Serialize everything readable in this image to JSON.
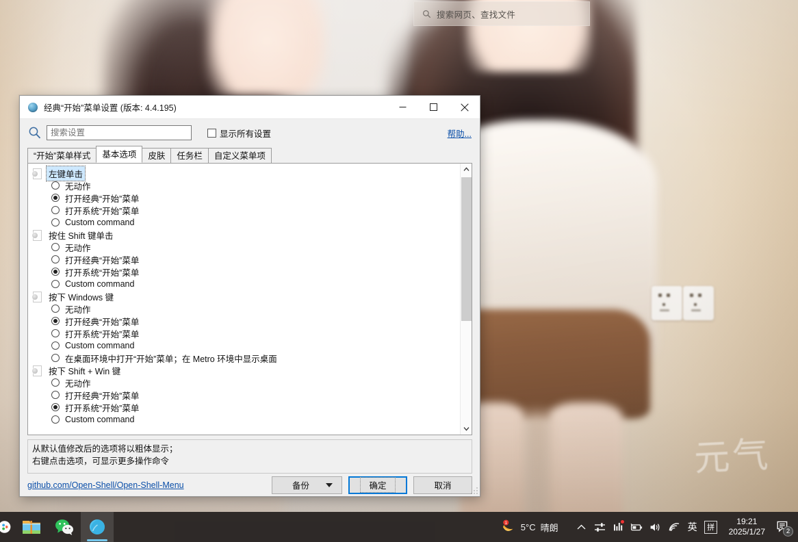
{
  "desktop": {
    "search": {
      "placeholder": "搜索网页、查找文件",
      "icon": "search-icon"
    },
    "watermark": "元气"
  },
  "dialog": {
    "title": "经典“开始”菜单设置 (版本: 4.4.195)",
    "icon": "open-shell-icon",
    "window_controls": {
      "minimize": "minimize-icon",
      "maximize": "maximize-icon",
      "close": "close-icon"
    },
    "search": {
      "placeholder": "搜索设置",
      "value": "",
      "icon": "magnifier-icon"
    },
    "show_all_checkbox": {
      "label": "显示所有设置",
      "checked": false
    },
    "help_link": "帮助...",
    "tabs": [
      {
        "label": "“开始”菜单样式",
        "active": false
      },
      {
        "label": "基本选项",
        "active": true
      },
      {
        "label": "皮肤",
        "active": false
      },
      {
        "label": "任务栏",
        "active": false
      },
      {
        "label": "自定义菜单项",
        "active": false
      }
    ],
    "groups": [
      {
        "label": "左键单击",
        "selected": true,
        "options": [
          {
            "label": "无动作",
            "checked": false
          },
          {
            "label": "打开经典“开始”菜单",
            "checked": true
          },
          {
            "label": "打开系统“开始”菜单",
            "checked": false
          },
          {
            "label": "Custom command",
            "checked": false
          }
        ]
      },
      {
        "label": "按住 Shift 键单击",
        "selected": false,
        "options": [
          {
            "label": "无动作",
            "checked": false
          },
          {
            "label": "打开经典“开始”菜单",
            "checked": false
          },
          {
            "label": "打开系统“开始”菜单",
            "checked": true
          },
          {
            "label": "Custom command",
            "checked": false
          }
        ]
      },
      {
        "label": "按下 Windows 键",
        "selected": false,
        "options": [
          {
            "label": "无动作",
            "checked": false
          },
          {
            "label": "打开经典“开始”菜单",
            "checked": true
          },
          {
            "label": "打开系统“开始”菜单",
            "checked": false
          },
          {
            "label": "Custom command",
            "checked": false
          },
          {
            "label": "在桌面环境中打开“开始”菜单；在 Metro 环境中显示桌面",
            "checked": false
          }
        ]
      },
      {
        "label": "按下 Shift + Win 键",
        "selected": false,
        "options": [
          {
            "label": "无动作",
            "checked": false
          },
          {
            "label": "打开经典“开始”菜单",
            "checked": false
          },
          {
            "label": "打开系统“开始”菜单",
            "checked": true
          },
          {
            "label": "Custom command",
            "checked": false
          }
        ]
      }
    ],
    "hint": {
      "line1": "从默认值修改后的选项将以粗体显示；",
      "line2": "右键点击选项，可显示更多操作命令"
    },
    "footer": {
      "github_link": "github.com/Open-Shell/Open-Shell-Menu",
      "backup_button": "备份",
      "ok_button": "确定",
      "cancel_button": "取消"
    },
    "accent_color": "#0078d7"
  },
  "taskbar": {
    "apps": [
      {
        "name": "edge-app",
        "active": false
      },
      {
        "name": "file-explorer-app",
        "active": false
      },
      {
        "name": "wechat-app",
        "active": false
      },
      {
        "name": "open-shell-app",
        "active": true
      }
    ],
    "weather": {
      "temperature": "5°C",
      "condition": "晴朗",
      "icon": "moon-icon"
    },
    "tray_icons": [
      "chevron-up-icon",
      "sliders-icon",
      "equalizer-icon",
      "battery-icon",
      "speaker-icon",
      "wifi-icon"
    ],
    "ime": {
      "language": "英",
      "mode": "拼"
    },
    "clock": {
      "time": "19:21",
      "date": "2025/1/27"
    },
    "notifications": {
      "count": "2",
      "icon": "notification-icon"
    }
  }
}
